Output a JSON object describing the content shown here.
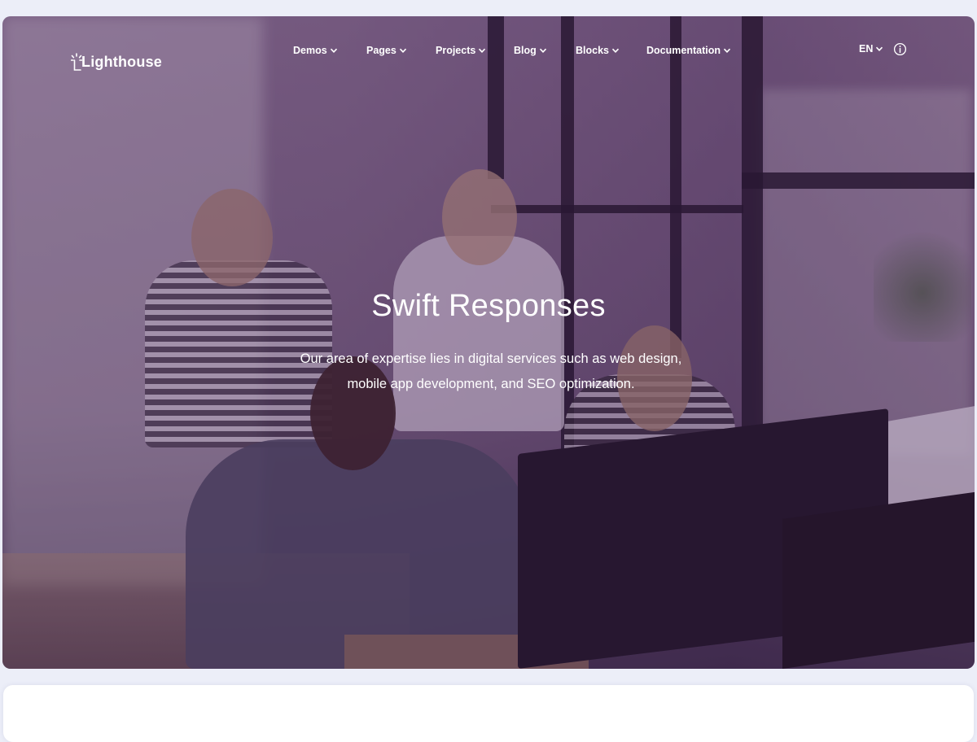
{
  "brand": {
    "name": "Lighthouse"
  },
  "nav": {
    "items": [
      {
        "label": "Demos"
      },
      {
        "label": "Pages"
      },
      {
        "label": "Projects"
      },
      {
        "label": "Blog"
      },
      {
        "label": "Blocks"
      },
      {
        "label": "Documentation"
      }
    ],
    "language": "EN",
    "icons": {
      "dropdown": "chevron-down-icon",
      "info": "info-icon",
      "logo": "lighthouse-icon"
    }
  },
  "hero": {
    "title": "Swift Responses",
    "text": "Our area of expertise lies in digital services such as web design, mobile app development, and SEO optimization."
  },
  "colors": {
    "page_bg": "#eceef8",
    "overlay": "#46225a",
    "text": "#ffffff",
    "card_bg": "#ffffff"
  }
}
